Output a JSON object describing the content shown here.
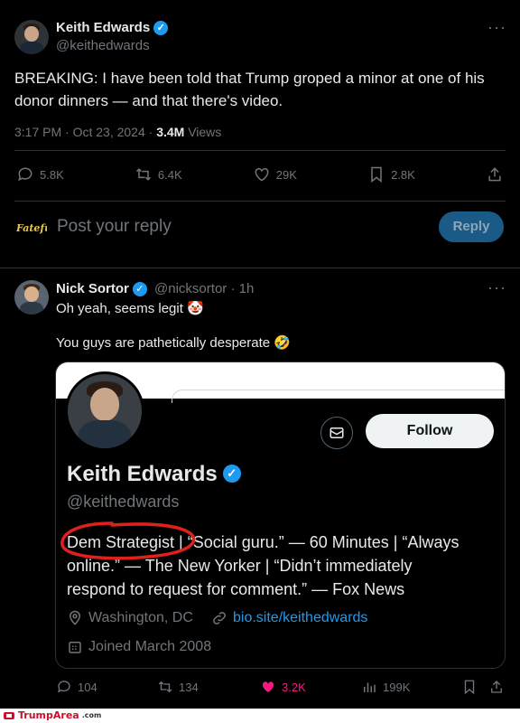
{
  "tweet": {
    "author_name": "Keith Edwards",
    "handle": "@keithedwards",
    "text": "BREAKING: I have been told that Trump groped a minor at one of his donor dinners — and that there's video.",
    "time": "3:17 PM · Oct 23, 2024 · ",
    "views_count": "3.4M",
    "views_label": " Views",
    "replies": "5.8K",
    "retweets": "6.4K",
    "likes": "29K",
    "bookmarks": "2.8K"
  },
  "reply_box": {
    "placeholder": "Post your reply",
    "button": "Reply"
  },
  "reply": {
    "author_name": "Nick Sortor",
    "handle_time": "@nicksortor · 1h",
    "line1": "Oh yeah, seems legit 🤡",
    "line2": "You guys are pathetically desperate 🤣",
    "replies": "104",
    "retweets": "134",
    "likes": "3.2K",
    "views": "199K"
  },
  "profile_card": {
    "follow": "Follow",
    "name": "Keith Edwards",
    "handle": "@keithedwards",
    "bio_line1": "Dem Strategist | “Social guru.” — 60 Minutes | “Always",
    "bio_line2": "online.” — The New Yorker | “Didn’t immediately",
    "bio_line3": "respond to request for comment.” — Fox News",
    "location": "Washington, DC",
    "link": "bio.site/keithedwards",
    "joined": "Joined March 2008"
  },
  "footer": {
    "brand": "TrumpArea",
    "domain": ".com"
  },
  "colors": {
    "accent": "#1d9bf0",
    "like_active": "#f91880",
    "circle_annotation": "#e0201b"
  }
}
